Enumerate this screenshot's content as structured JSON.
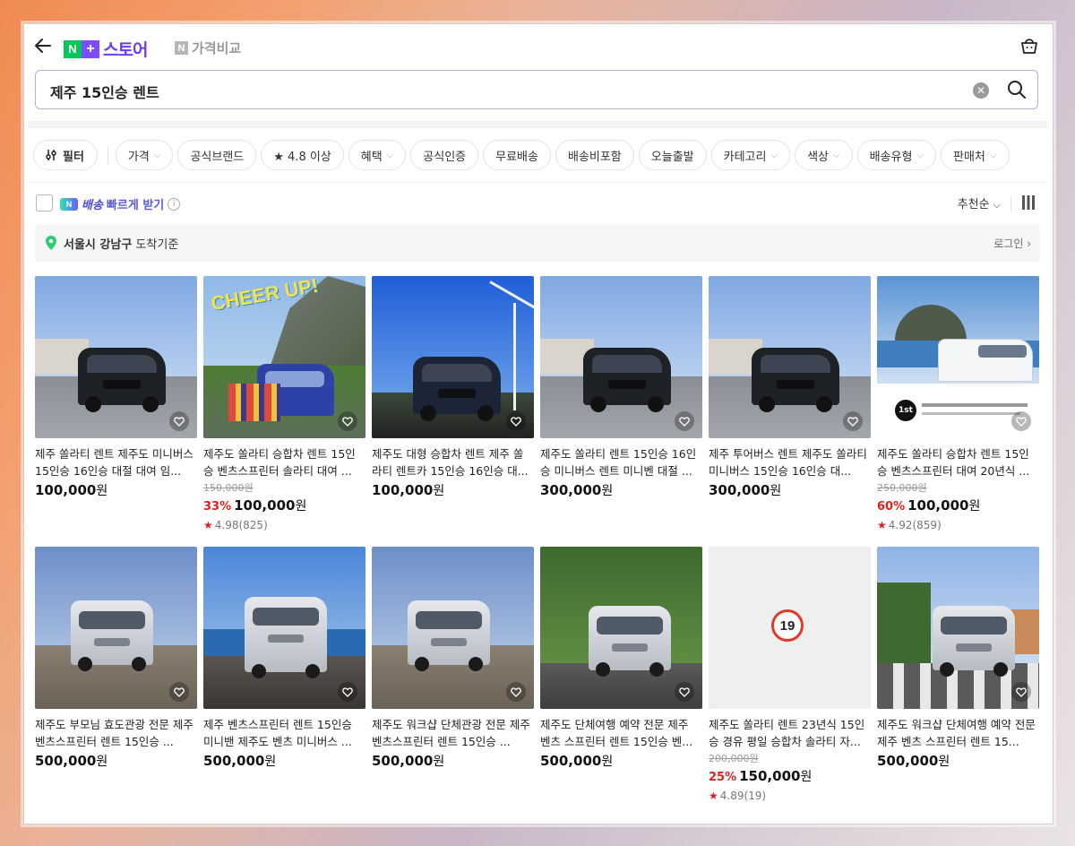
{
  "header": {
    "logo_n": "N",
    "logo_plus": "+",
    "logo_text": "스토어",
    "price_compare_badge": "N",
    "price_compare_label": "가격비교"
  },
  "search": {
    "query": "제주 15인승 렌트"
  },
  "filters": [
    {
      "label": "필터",
      "has_chevron": false
    },
    {
      "label": "가격",
      "has_chevron": true
    },
    {
      "label": "공식브랜드",
      "has_chevron": false
    },
    {
      "label": "★ 4.8 이상",
      "has_chevron": false
    },
    {
      "label": "혜택",
      "has_chevron": true
    },
    {
      "label": "공식인증",
      "has_chevron": false
    },
    {
      "label": "무료배송",
      "has_chevron": false
    },
    {
      "label": "배송비포함",
      "has_chevron": false
    },
    {
      "label": "오늘출발",
      "has_chevron": false
    },
    {
      "label": "카테고리",
      "has_chevron": true
    },
    {
      "label": "색상",
      "has_chevron": true
    },
    {
      "label": "배송유형",
      "has_chevron": true
    },
    {
      "label": "판매처",
      "has_chevron": true
    }
  ],
  "toolbar": {
    "fast_badge": "N",
    "fast_label_1": "배송",
    "fast_label_2": "빠르게 받기",
    "info": "i",
    "sort_label": "추천순"
  },
  "location": {
    "region": "서울시 강남구",
    "suffix": "도착기준",
    "login_label": "로그인"
  },
  "products": [
    {
      "title": "제주 쏠라티 렌트 제주도 미니버스 15인승 16인승 대절 대여 임...",
      "original_price": "",
      "discount": "",
      "price": "100,000",
      "currency": "원",
      "rating": "",
      "reviews": "",
      "image": "dark-van"
    },
    {
      "title": "제주도 쏠라티 승합차 렌트 15인승 벤츠스프린터 솔라티 대여 ...",
      "original_price": "150,000원",
      "discount": "33%",
      "price": "100,000",
      "currency": "원",
      "rating": "4.98",
      "reviews": "(825)",
      "image": "group-blue-van",
      "badge": "CHEER UP!"
    },
    {
      "title": "제주도 대형 승합차 렌트 제주 쏠라티 렌트카 15인승 16인승 대...",
      "original_price": "",
      "discount": "",
      "price": "100,000",
      "currency": "원",
      "rating": "",
      "reviews": "",
      "image": "dark-van-windmill"
    },
    {
      "title": "제주도 쏠라티 렌트 15인승 16인승 미니버스 렌트 미니벤 대절 ...",
      "original_price": "",
      "discount": "",
      "price": "300,000",
      "currency": "원",
      "rating": "",
      "reviews": "",
      "image": "dark-van"
    },
    {
      "title": "제주 투어버스 렌트 제주도 쏠라티 미니버스 15인승 16인승 대...",
      "original_price": "",
      "discount": "",
      "price": "300,000",
      "currency": "원",
      "rating": "",
      "reviews": "",
      "image": "dark-van"
    },
    {
      "title": "제주도 쏠라티 승합차 렌트 15인승 벤츠스프린터 대여 20년식 ...",
      "original_price": "250,000원",
      "discount": "60%",
      "price": "100,000",
      "currency": "원",
      "rating": "4.92",
      "reviews": "(859)",
      "image": "white-van-sanbang",
      "badge": "1st"
    },
    {
      "title": "제주도 부모님 효도관광 전문 제주 벤츠스프린터 렌트 15인승 ...",
      "original_price": "",
      "discount": "",
      "price": "500,000",
      "currency": "원",
      "rating": "",
      "reviews": "",
      "image": "silver-van-coast"
    },
    {
      "title": "제주 벤츠스프린터 렌트 15인승 미니밴 제주도 벤츠 미니버스 ...",
      "original_price": "",
      "discount": "",
      "price": "500,000",
      "currency": "원",
      "rating": "",
      "reviews": "",
      "image": "silver-van-sea"
    },
    {
      "title": "제주도 워크샵 단체관광 전문 제주 벤츠스프린터 렌트 15인승 ...",
      "original_price": "",
      "discount": "",
      "price": "500,000",
      "currency": "원",
      "rating": "",
      "reviews": "",
      "image": "silver-van-coast"
    },
    {
      "title": "제주도 단체여행 예약 전문 제주 벤츠 스프린터 렌트 15인승 벤...",
      "original_price": "",
      "discount": "",
      "price": "500,000",
      "currency": "원",
      "rating": "",
      "reviews": "",
      "image": "silver-van-forest"
    },
    {
      "title": "제주도 쏠라티 렌트 23년식 15인승 경유 평일 승합차 솔라티 자...",
      "original_price": "200,000원",
      "discount": "25%",
      "price": "150,000",
      "currency": "원",
      "rating": "4.89",
      "reviews": "(19)",
      "image": "age-19",
      "badge": "19"
    },
    {
      "title": "제주도 워크샵 단체여행 예약 전문 제주 벤츠 스프린터 렌트 15...",
      "original_price": "",
      "discount": "",
      "price": "500,000",
      "currency": "원",
      "rating": "",
      "reviews": "",
      "image": "silver-van-crosswalk"
    }
  ]
}
